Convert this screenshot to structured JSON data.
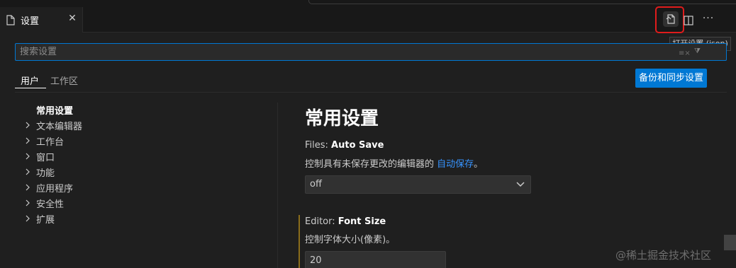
{
  "tab": {
    "label": "设置",
    "close_glyph": "✕",
    "icon": "file-icon"
  },
  "actions": {
    "open_json_icon": "open-json-icon",
    "split_icon": "split-editor-icon",
    "more_glyph": "···"
  },
  "tooltip": "打开设置 (json)",
  "search": {
    "placeholder": "搜索设置",
    "value": ""
  },
  "scopes": {
    "user": "用户",
    "workspace": "工作区"
  },
  "sync_button": "备份和同步设置",
  "toc": {
    "title": "常用设置",
    "items": [
      {
        "label": "文本编辑器"
      },
      {
        "label": "工作台"
      },
      {
        "label": "窗口"
      },
      {
        "label": "功能"
      },
      {
        "label": "应用程序"
      },
      {
        "label": "安全性"
      },
      {
        "label": "扩展"
      }
    ]
  },
  "section_title": "常用设置",
  "settings": {
    "auto_save": {
      "category": "Files: ",
      "name": "Auto Save",
      "desc_prefix": "控制具有未保存更改的编辑器的 ",
      "desc_link": "自动保存",
      "desc_suffix": "。",
      "value": "off"
    },
    "font_size": {
      "category": "Editor: ",
      "name": "Font Size",
      "desc": "控制字体大小(像素)。",
      "value": "20"
    }
  },
  "watermark": "@稀土掘金技术社区",
  "colors": {
    "accent": "#0078d4",
    "highlight": "#e01c1c",
    "link": "#3794ff",
    "modified": "#8a6d1b"
  }
}
